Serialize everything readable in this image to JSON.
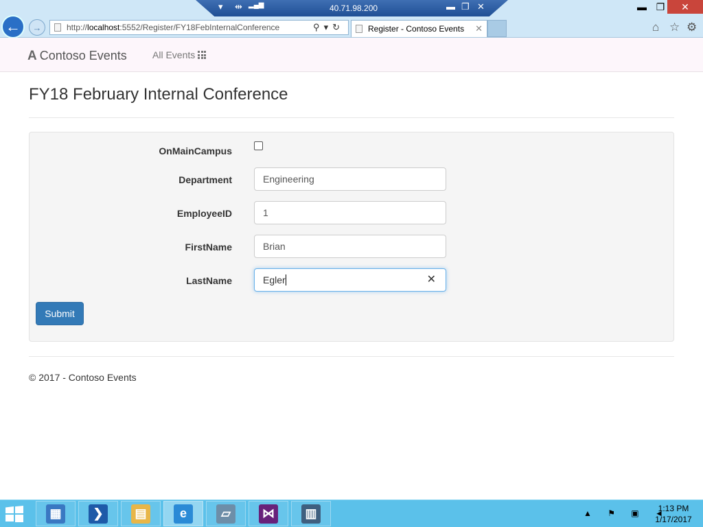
{
  "browser": {
    "rdp_ip": "40.71.98.200",
    "address_prefix": "http://",
    "address_host": "localhost",
    "address_rest": ":5552/Register/FY18FebInternalConference",
    "tab_title": "Register - Contoso Events",
    "window_controls": {
      "minimize": "▬",
      "restore": "❐",
      "close": "✕"
    },
    "rdp_controls": {
      "pin": "▾",
      "connection": "⇹",
      "signal": "▂▄▆"
    }
  },
  "navbar": {
    "brand_logo": "A",
    "brand": "Contoso Events",
    "all_events": "All Events"
  },
  "page": {
    "title": "FY18 February Internal Conference",
    "form": {
      "on_main_campus_label": "OnMainCampus",
      "on_main_campus_checked": false,
      "department_label": "Department",
      "department_value": "Engineering",
      "employee_id_label": "EmployeeID",
      "employee_id_value": "1",
      "first_name_label": "FirstName",
      "first_name_value": "Brian",
      "last_name_label": "LastName",
      "last_name_value": "Egler",
      "clear_glyph": "✕",
      "submit_label": "Submit"
    },
    "footer": "© 2017 - Contoso Events"
  },
  "taskbar": {
    "time": "1:13 PM",
    "date": "1/17/2017",
    "tray_glyphs": "▲ ⚑ ▣ ◄",
    "pinned": [
      {
        "name": "server-manager",
        "glyph": "▦",
        "color": "#3a78c2"
      },
      {
        "name": "powershell",
        "glyph": "❯",
        "color": "#1e5aa8"
      },
      {
        "name": "file-explorer",
        "glyph": "▤",
        "color": "#e8b648"
      },
      {
        "name": "internet-explorer",
        "glyph": "e",
        "color": "#2a8ad6"
      },
      {
        "name": "notepad",
        "glyph": "▱",
        "color": "#6d8ea8"
      },
      {
        "name": "visual-studio",
        "glyph": "⋈",
        "color": "#68217a"
      },
      {
        "name": "app-window",
        "glyph": "▥",
        "color": "#3f5f7f"
      }
    ]
  },
  "colors": {
    "primary": "#337ab7",
    "taskbar": "#5bc1ea",
    "navbar_bg": "#fdf6fb"
  }
}
